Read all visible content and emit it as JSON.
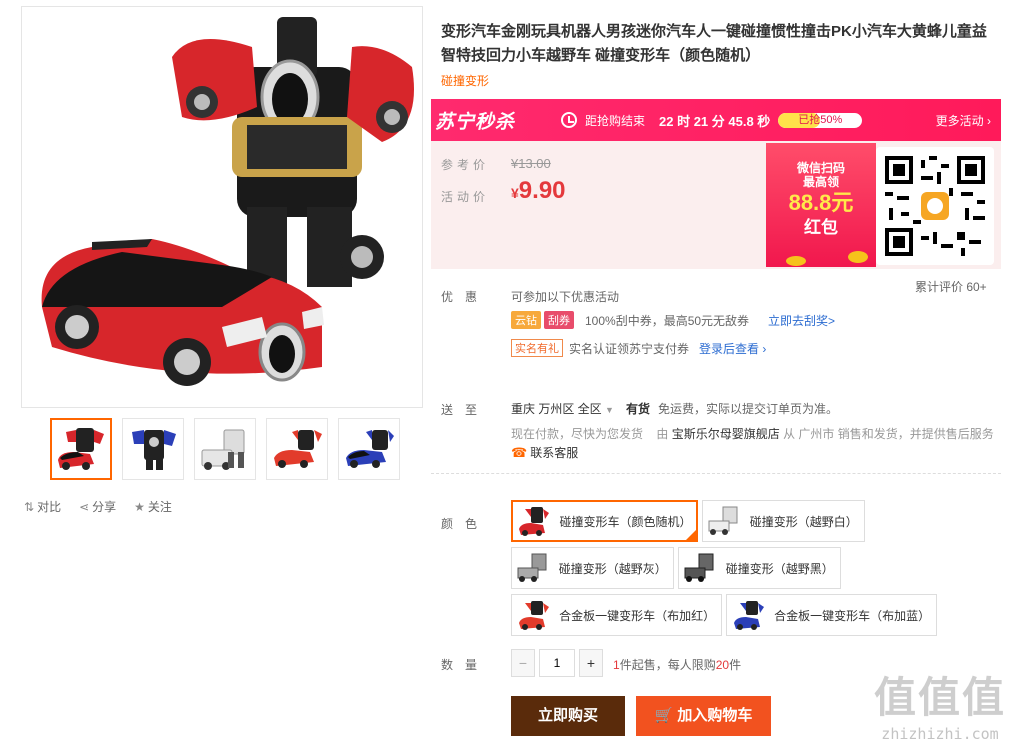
{
  "product": {
    "title": "变形汽车金刚玩具机器人男孩迷你汽车人一键碰撞惯性撞击PK小汽车大黄蜂儿童益智特技回力小车越野车 碰撞变形车（颜色随机）",
    "subtitle": "碰撞变形"
  },
  "gallery": {
    "actions": {
      "compare": "对比",
      "share": "分享",
      "follow": "关注"
    }
  },
  "flash": {
    "logo": "苏宁秒杀",
    "countdown_label": "距抢购结束",
    "countdown": "22 时 21 分 45.8 秒",
    "sold_label": "已抢50%",
    "sold_fraction": 0.5,
    "more": "更多活动 ›"
  },
  "price": {
    "ref_label": "参考价",
    "ref_value": "¥13.00",
    "act_label": "活动价",
    "currency": "¥",
    "act_value": "9.90"
  },
  "redpacket": {
    "line1": "微信扫码",
    "line2": "最高领",
    "amount": "88.8元",
    "line3": "红包"
  },
  "reviews": "累计评价 60+",
  "promo": {
    "label": "优惠",
    "intro": "可参加以下优惠活动",
    "tag1": "云钻",
    "tag2": "刮券",
    "desc1": "100%刮中券，最高50元无敌券",
    "link1": "立即去刮奖>",
    "tag3": "实名有礼",
    "desc2": "实名认证领苏宁支付券",
    "link2": "登录后查看 ›"
  },
  "delivery": {
    "label": "送至",
    "location": "重庆 万州区 全区",
    "stock": "有货",
    "note": "免运费，实际以提交订单页为准。",
    "line2_a": "现在付款，尽快为您发货",
    "line2_b": "由",
    "store": "宝斯乐尔母婴旗舰店",
    "line2_c": "从 广州市 销售和发货，并提供售后服务",
    "service": "联系客服"
  },
  "color": {
    "label": "颜色",
    "options": [
      "碰撞变形车（颜色随机）",
      "碰撞变形（越野白）",
      "碰撞变形（越野灰）",
      "碰撞变形（越野黑）",
      "合金板一键变形车（布加红）",
      "合金板一键变形车（布加蓝）"
    ]
  },
  "quantity": {
    "label": "数量",
    "minus": "−",
    "value": "1",
    "plus": "+",
    "min_num": "1",
    "min_text": "件起售，每人限购",
    "limit_num": "20",
    "limit_unit": "件"
  },
  "buttons": {
    "buy": "立即购买",
    "cart": "加入购物车"
  },
  "watermark": {
    "big": "值值值",
    "small": "zhizhizhi.com"
  },
  "colors": {
    "accent": "#ff6600",
    "flash": "#ff2a6e",
    "price": "#e4393c",
    "buy": "#5a2b0b",
    "cart": "#f2521f"
  }
}
